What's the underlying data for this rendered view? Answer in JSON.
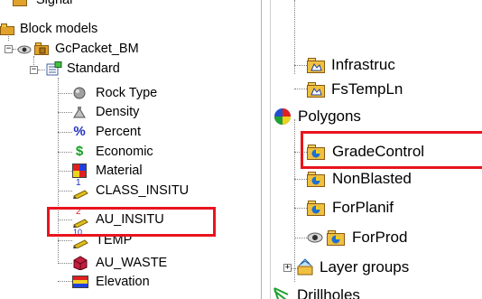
{
  "left_tree": {
    "partial_top_label": "Signal",
    "block_models": "Block models",
    "packet": "GcPacket_BM",
    "standard": "Standard",
    "items": [
      {
        "label": "Rock Type",
        "icon": "rock-type-icon"
      },
      {
        "label": "Density",
        "icon": "density-icon"
      },
      {
        "label": "Percent",
        "icon": "percent-icon"
      },
      {
        "label": "Economic",
        "icon": "economic-icon"
      },
      {
        "label": "Material",
        "icon": "material-icon"
      },
      {
        "label": "CLASS_INSITU",
        "icon": "pencil-1-icon",
        "index": "1"
      },
      {
        "label": "AU_INSITU",
        "icon": "pencil-2-icon",
        "index": "2"
      },
      {
        "label": "TEMP",
        "icon": "pencil-10-icon",
        "index": "10"
      },
      {
        "label": "AU_WASTE",
        "icon": "cube-icon"
      },
      {
        "label": "Elevation",
        "icon": "elevation-icon"
      }
    ],
    "percent_symbol": "%",
    "economic_symbol": "$"
  },
  "right_tree": {
    "items": [
      {
        "label": "Infrastruc",
        "icon": "layer-folder-icon"
      },
      {
        "label": "FsTempLn",
        "icon": "layer-folder-icon"
      },
      {
        "label": "Polygons",
        "icon": "polygons-icon"
      },
      {
        "label": "GradeControl",
        "icon": "polygon-folder-icon"
      },
      {
        "label": "NonBlasted",
        "icon": "polygon-folder-icon"
      },
      {
        "label": "ForPlanif",
        "icon": "polygon-folder-icon"
      },
      {
        "label": "ForProd",
        "icon": "polygon-folder-icon"
      },
      {
        "label": "Layer groups",
        "icon": "layer-groups-icon"
      },
      {
        "label": "Drillholes",
        "icon": "drillholes-icon"
      }
    ]
  },
  "colors": {
    "highlight": "#e8141e",
    "folder": "#e0a22a",
    "polygon_blue": "#1f6fd0"
  }
}
